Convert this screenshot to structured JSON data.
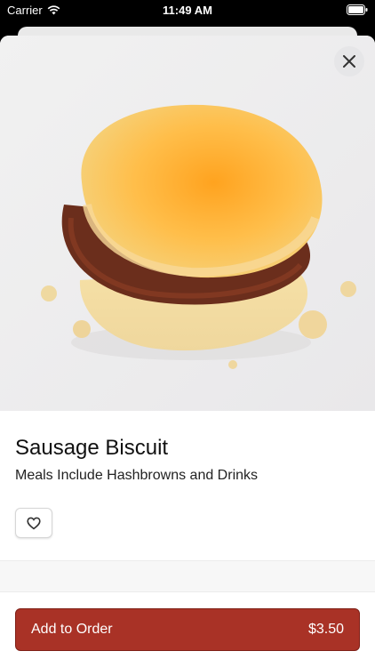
{
  "status_bar": {
    "carrier": "Carrier",
    "time": "11:49 AM"
  },
  "item": {
    "name": "Sausage Biscuit",
    "description": "Meals Include Hashbrowns and Drinks",
    "image": "sausage-biscuit-photo"
  },
  "actions": {
    "add_label": "Add to Order",
    "price": "$3.50",
    "close_icon": "close-icon",
    "favorite_icon": "heart-outline-icon"
  },
  "colors": {
    "accent": "#a93226",
    "sheet_background": "#ffffff",
    "status_bar_background": "#000000"
  }
}
